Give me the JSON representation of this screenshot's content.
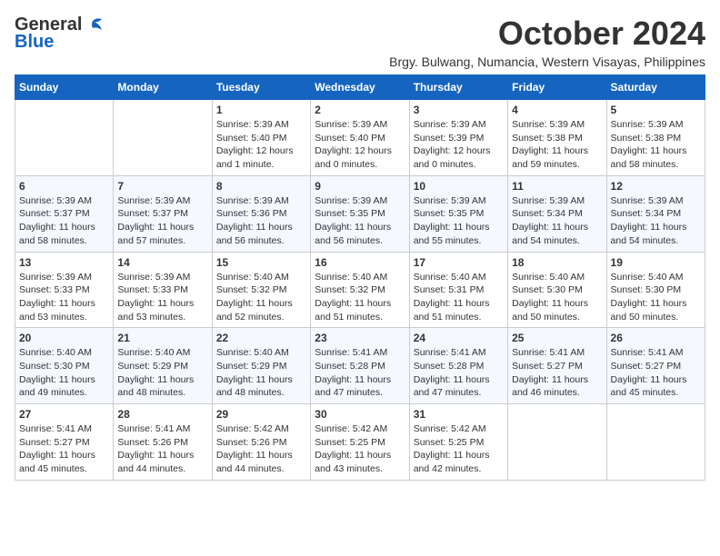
{
  "logo": {
    "line1": "General",
    "line2": "Blue"
  },
  "title": "October 2024",
  "subtitle": "Brgy. Bulwang, Numancia, Western Visayas, Philippines",
  "weekdays": [
    "Sunday",
    "Monday",
    "Tuesday",
    "Wednesday",
    "Thursday",
    "Friday",
    "Saturday"
  ],
  "weeks": [
    [
      {
        "day": "",
        "info": ""
      },
      {
        "day": "",
        "info": ""
      },
      {
        "day": "1",
        "info": "Sunrise: 5:39 AM\nSunset: 5:40 PM\nDaylight: 12 hours\nand 1 minute."
      },
      {
        "day": "2",
        "info": "Sunrise: 5:39 AM\nSunset: 5:40 PM\nDaylight: 12 hours\nand 0 minutes."
      },
      {
        "day": "3",
        "info": "Sunrise: 5:39 AM\nSunset: 5:39 PM\nDaylight: 12 hours\nand 0 minutes."
      },
      {
        "day": "4",
        "info": "Sunrise: 5:39 AM\nSunset: 5:38 PM\nDaylight: 11 hours\nand 59 minutes."
      },
      {
        "day": "5",
        "info": "Sunrise: 5:39 AM\nSunset: 5:38 PM\nDaylight: 11 hours\nand 58 minutes."
      }
    ],
    [
      {
        "day": "6",
        "info": "Sunrise: 5:39 AM\nSunset: 5:37 PM\nDaylight: 11 hours\nand 58 minutes."
      },
      {
        "day": "7",
        "info": "Sunrise: 5:39 AM\nSunset: 5:37 PM\nDaylight: 11 hours\nand 57 minutes."
      },
      {
        "day": "8",
        "info": "Sunrise: 5:39 AM\nSunset: 5:36 PM\nDaylight: 11 hours\nand 56 minutes."
      },
      {
        "day": "9",
        "info": "Sunrise: 5:39 AM\nSunset: 5:35 PM\nDaylight: 11 hours\nand 56 minutes."
      },
      {
        "day": "10",
        "info": "Sunrise: 5:39 AM\nSunset: 5:35 PM\nDaylight: 11 hours\nand 55 minutes."
      },
      {
        "day": "11",
        "info": "Sunrise: 5:39 AM\nSunset: 5:34 PM\nDaylight: 11 hours\nand 54 minutes."
      },
      {
        "day": "12",
        "info": "Sunrise: 5:39 AM\nSunset: 5:34 PM\nDaylight: 11 hours\nand 54 minutes."
      }
    ],
    [
      {
        "day": "13",
        "info": "Sunrise: 5:39 AM\nSunset: 5:33 PM\nDaylight: 11 hours\nand 53 minutes."
      },
      {
        "day": "14",
        "info": "Sunrise: 5:39 AM\nSunset: 5:33 PM\nDaylight: 11 hours\nand 53 minutes."
      },
      {
        "day": "15",
        "info": "Sunrise: 5:40 AM\nSunset: 5:32 PM\nDaylight: 11 hours\nand 52 minutes."
      },
      {
        "day": "16",
        "info": "Sunrise: 5:40 AM\nSunset: 5:32 PM\nDaylight: 11 hours\nand 51 minutes."
      },
      {
        "day": "17",
        "info": "Sunrise: 5:40 AM\nSunset: 5:31 PM\nDaylight: 11 hours\nand 51 minutes."
      },
      {
        "day": "18",
        "info": "Sunrise: 5:40 AM\nSunset: 5:30 PM\nDaylight: 11 hours\nand 50 minutes."
      },
      {
        "day": "19",
        "info": "Sunrise: 5:40 AM\nSunset: 5:30 PM\nDaylight: 11 hours\nand 50 minutes."
      }
    ],
    [
      {
        "day": "20",
        "info": "Sunrise: 5:40 AM\nSunset: 5:30 PM\nDaylight: 11 hours\nand 49 minutes."
      },
      {
        "day": "21",
        "info": "Sunrise: 5:40 AM\nSunset: 5:29 PM\nDaylight: 11 hours\nand 48 minutes."
      },
      {
        "day": "22",
        "info": "Sunrise: 5:40 AM\nSunset: 5:29 PM\nDaylight: 11 hours\nand 48 minutes."
      },
      {
        "day": "23",
        "info": "Sunrise: 5:41 AM\nSunset: 5:28 PM\nDaylight: 11 hours\nand 47 minutes."
      },
      {
        "day": "24",
        "info": "Sunrise: 5:41 AM\nSunset: 5:28 PM\nDaylight: 11 hours\nand 47 minutes."
      },
      {
        "day": "25",
        "info": "Sunrise: 5:41 AM\nSunset: 5:27 PM\nDaylight: 11 hours\nand 46 minutes."
      },
      {
        "day": "26",
        "info": "Sunrise: 5:41 AM\nSunset: 5:27 PM\nDaylight: 11 hours\nand 45 minutes."
      }
    ],
    [
      {
        "day": "27",
        "info": "Sunrise: 5:41 AM\nSunset: 5:27 PM\nDaylight: 11 hours\nand 45 minutes."
      },
      {
        "day": "28",
        "info": "Sunrise: 5:41 AM\nSunset: 5:26 PM\nDaylight: 11 hours\nand 44 minutes."
      },
      {
        "day": "29",
        "info": "Sunrise: 5:42 AM\nSunset: 5:26 PM\nDaylight: 11 hours\nand 44 minutes."
      },
      {
        "day": "30",
        "info": "Sunrise: 5:42 AM\nSunset: 5:25 PM\nDaylight: 11 hours\nand 43 minutes."
      },
      {
        "day": "31",
        "info": "Sunrise: 5:42 AM\nSunset: 5:25 PM\nDaylight: 11 hours\nand 42 minutes."
      },
      {
        "day": "",
        "info": ""
      },
      {
        "day": "",
        "info": ""
      }
    ]
  ]
}
